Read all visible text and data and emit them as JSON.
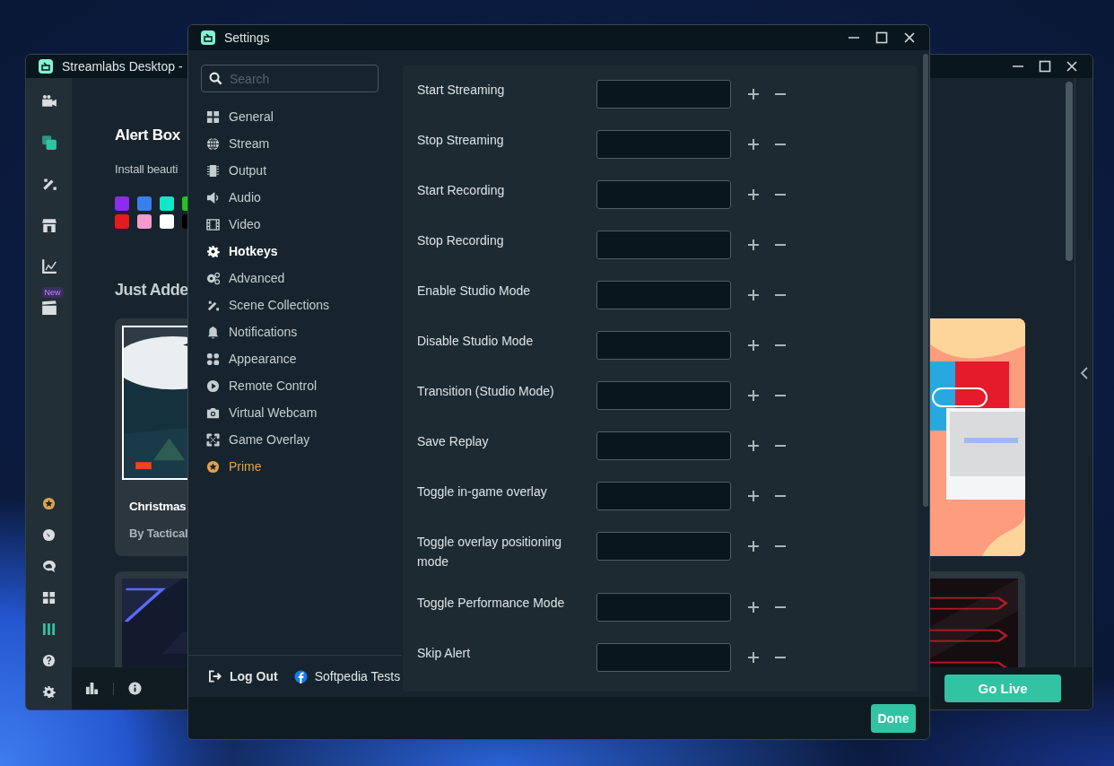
{
  "main_window": {
    "title": "Streamlabs Desktop -",
    "nav_top": [
      {
        "selected": false
      },
      {
        "selected": true
      },
      {
        "selected": false
      },
      {
        "selected": false
      },
      {
        "selected": false
      },
      {
        "selected": false,
        "badge": "New"
      }
    ],
    "nav_bottom": [
      {
        "selected": false
      },
      {
        "selected": false
      },
      {
        "selected": false
      },
      {
        "selected": false
      },
      {
        "selected": true
      },
      {
        "selected": false
      },
      {
        "selected": false
      }
    ],
    "heading": "Alert Box",
    "subtitle": "Install beauti",
    "swatches": [
      {
        "color": "#8b2cf0"
      },
      {
        "color": "#3a7ef0"
      },
      {
        "color": "#12e6c8"
      },
      {
        "color": "#22c41e"
      },
      {
        "color": "#e31b1f"
      },
      {
        "color": "#f59acb"
      },
      {
        "color": "#ffffff"
      },
      {
        "color": "#000000"
      }
    ],
    "section_title": "Just Adde",
    "featured_card": {
      "title": "Christmas",
      "author": "By Tactical"
    },
    "go_live": "Go Live"
  },
  "settings_window": {
    "title": "Settings",
    "search": {
      "placeholder": "Search"
    },
    "pages": [
      {
        "label": "General",
        "selected": false,
        "kind": "page"
      },
      {
        "label": "Stream",
        "selected": false,
        "kind": "page"
      },
      {
        "label": "Output",
        "selected": false,
        "kind": "page"
      },
      {
        "label": "Audio",
        "selected": false,
        "kind": "page"
      },
      {
        "label": "Video",
        "selected": false,
        "kind": "page"
      },
      {
        "label": "Hotkeys",
        "selected": true,
        "kind": "page"
      },
      {
        "label": "Advanced",
        "selected": false,
        "kind": "page"
      },
      {
        "label": "Scene Collections",
        "selected": false,
        "kind": "page"
      },
      {
        "label": "Notifications",
        "selected": false,
        "kind": "page"
      },
      {
        "label": "Appearance",
        "selected": false,
        "kind": "page"
      },
      {
        "label": "Remote Control",
        "selected": false,
        "kind": "page"
      },
      {
        "label": "Virtual Webcam",
        "selected": false,
        "kind": "page"
      },
      {
        "label": "Game Overlay",
        "selected": false,
        "kind": "page"
      },
      {
        "label": "Prime",
        "selected": false,
        "kind": "premium"
      }
    ],
    "log_out": "Log Out",
    "account": "Softpedia Tests",
    "hotkeys": [
      {
        "label": "Start Streaming"
      },
      {
        "label": "Stop Streaming"
      },
      {
        "label": "Start Recording"
      },
      {
        "label": "Stop Recording"
      },
      {
        "label": "Enable Studio Mode"
      },
      {
        "label": "Disable Studio Mode"
      },
      {
        "label": "Transition (Studio Mode)"
      },
      {
        "label": "Save Replay"
      },
      {
        "label": "Toggle in-game overlay"
      },
      {
        "label": "Toggle overlay positioning mode"
      },
      {
        "label": "Toggle Performance Mode"
      },
      {
        "label": "Skip Alert"
      }
    ],
    "done": "Done"
  }
}
